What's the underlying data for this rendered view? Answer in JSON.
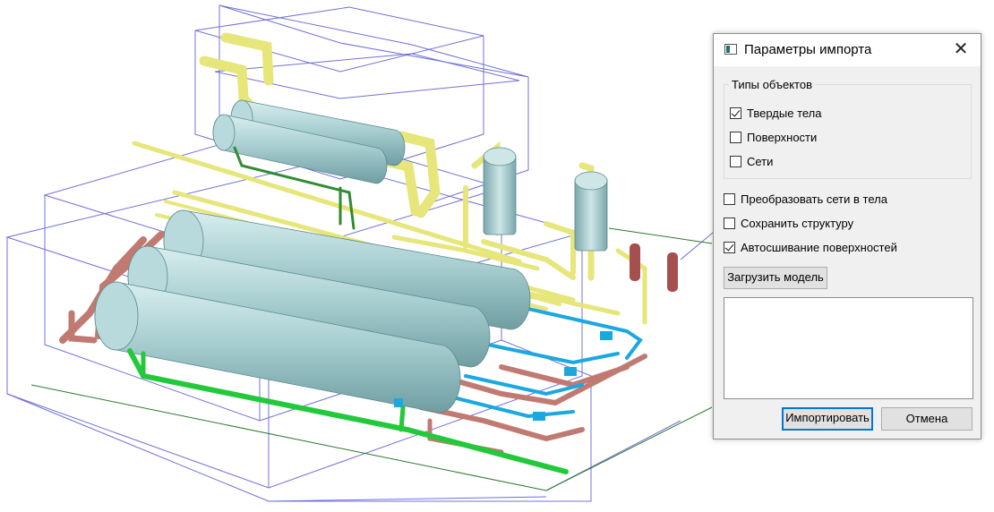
{
  "dialog": {
    "title": "Параметры импорта",
    "close_glyph": "✕",
    "object_types": {
      "legend": "Типы объектов",
      "items": [
        {
          "label": "Твердые тела",
          "checked": true
        },
        {
          "label": "Поверхности",
          "checked": false
        },
        {
          "label": "Сети",
          "checked": false
        }
      ]
    },
    "options": [
      {
        "label": "Преобразовать сети в тела",
        "checked": false
      },
      {
        "label": "Сохранить структуру",
        "checked": false
      },
      {
        "label": "Автосшивание поверхностей",
        "checked": true
      }
    ],
    "load_model_label": "Загрузить модель",
    "log_text": "",
    "import_label": "Импортировать",
    "cancel_label": "Отмена"
  },
  "icons": {
    "app": "app-window-icon",
    "close": "close-icon",
    "check": "checkmark-icon"
  },
  "colors": {
    "vessel": "#a9cfd1",
    "pipe_yellow": "#ecec8e",
    "pipe_green": "#22c93a",
    "pipe_blue": "#1aa8e0",
    "pipe_red": "#c07a72",
    "bbox_lines": "#6f6fd8",
    "accent": "#0078d7"
  }
}
